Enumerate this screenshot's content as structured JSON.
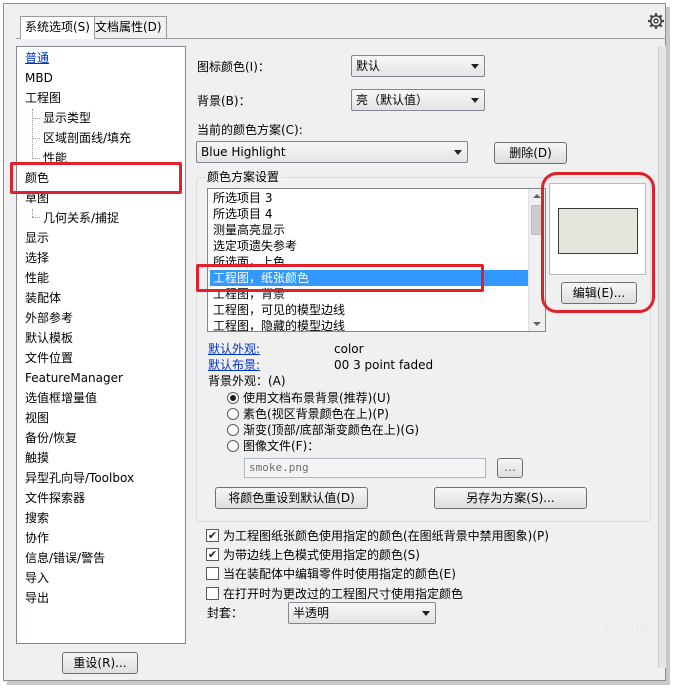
{
  "tabs": [
    "系统选项(S)",
    "文档属性(D)"
  ],
  "tree": {
    "items": [
      "普通",
      "MBD",
      "工程图",
      "显示类型",
      "区域剖面线/填充",
      "性能",
      "颜色",
      "草图",
      "几何关系/捕捉",
      "显示",
      "选择",
      "性能",
      "装配体",
      "外部参考",
      "默认模板",
      "文件位置",
      "FeatureManager",
      "选值框增量值",
      "视图",
      "备份/恢复",
      "触摸",
      "异型孔向导/Toolbox",
      "文件探索器",
      "搜索",
      "协作",
      "信息/错误/警告",
      "导入",
      "导出"
    ],
    "reset_button": "重设(R)..."
  },
  "icon_color": {
    "label": "图标颜色(I)：",
    "value": "默认"
  },
  "background": {
    "label": "背景(B)：",
    "value": "亮（默认值）"
  },
  "scheme": {
    "label": "当前的颜色方案(C):",
    "value": "Blue Highlight",
    "delete_button": "删除(D)"
  },
  "scheme_settings": {
    "legend": "颜色方案设置",
    "items": [
      "所选项目 3",
      "所选项目 4",
      "测量高亮显示",
      "选定项遗失参考",
      "所选面，上色",
      "工程图，纸张颜色",
      "工程图，背景",
      "工程图，可见的模型边线",
      "工程图，隐藏的模型边线"
    ],
    "selected_index": 5,
    "swatch_color": "#e6e5dd",
    "edit_button": "编辑(E)...",
    "default_appearance_label": "默认外观:",
    "default_appearance_value": "color",
    "default_scene_label": "默认布景:",
    "default_scene_value": "00 3 point faded",
    "bg_appearance_label": "背景外观：(A)",
    "bg_options": [
      "使用文档布景背景(推荐)(U)",
      "素色(视区背景颜色在上)(P)",
      "渐变(顶部/底部渐变颜色在上)(G)",
      "图像文件(F)："
    ],
    "bg_selected_index": 0,
    "image_file": "smoke.png",
    "browse_button": "...",
    "reset_colors_button": "将颜色重设到默认值(D)",
    "save_as_button": "另存为方案(S)..."
  },
  "checkboxes": [
    {
      "label": "为工程图纸张颜色使用指定的颜色(在图纸背景中禁用图象)(P)",
      "checked": true
    },
    {
      "label": "为带边线上色模式使用指定的颜色(S)",
      "checked": true
    },
    {
      "label": "当在装配体中编辑零件时使用指定的颜色(E)",
      "checked": false
    },
    {
      "label": "在打开时为更改过的工程图尺寸使用指定颜色",
      "checked": false
    }
  ],
  "envelope": {
    "label": "封套：",
    "value": "半透明"
  },
  "watermark": "工程帅"
}
